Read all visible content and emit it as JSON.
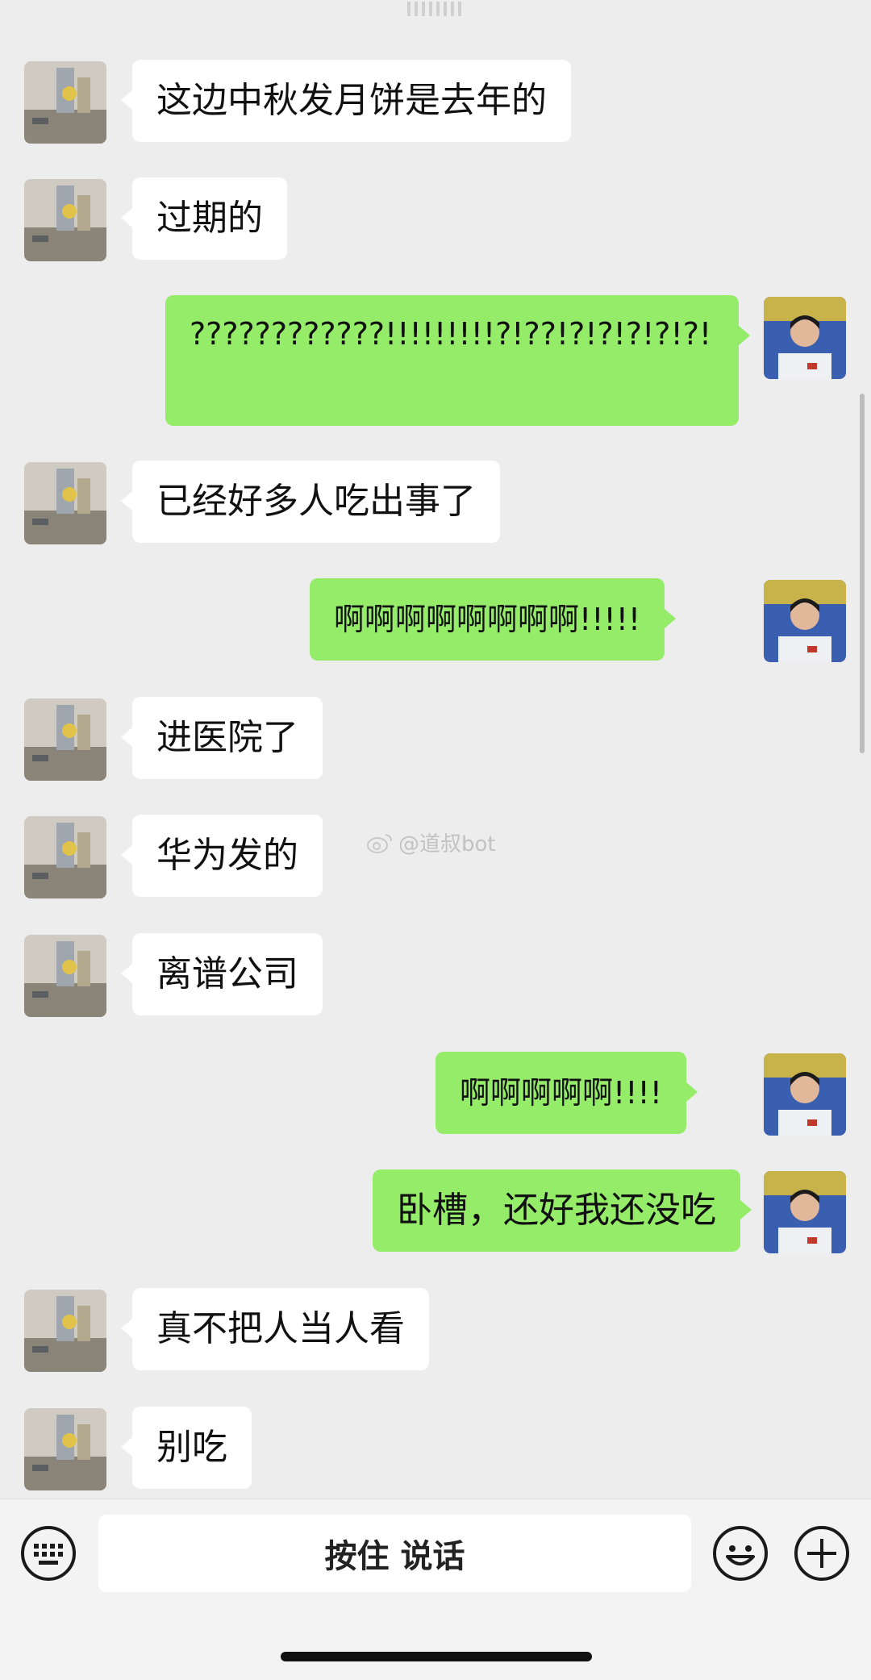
{
  "messages": [
    {
      "side": "them",
      "text": "这边中秋发月饼是去年的"
    },
    {
      "side": "them",
      "text": "过期的"
    },
    {
      "side": "me",
      "text": "????????????!!!!!!!!!?!??!?!?!?!?!?!"
    },
    {
      "side": "them",
      "text": "已经好多人吃出事了"
    },
    {
      "side": "me",
      "text": "啊啊啊啊啊啊啊啊!!!!!"
    },
    {
      "side": "them",
      "text": "进医院了"
    },
    {
      "side": "them",
      "text": "华为发的"
    },
    {
      "side": "them",
      "text": "离谱公司"
    },
    {
      "side": "me",
      "text": "啊啊啊啊啊!!!!"
    },
    {
      "side": "me",
      "text": "卧槽，还好我还没吃"
    },
    {
      "side": "them",
      "text": "真不把人当人看"
    },
    {
      "side": "them",
      "text": "别吃"
    }
  ],
  "watermark": "@道叔bot",
  "input_bar": {
    "voice_label": "按住 说话",
    "keyboard_icon": "keyboard-icon",
    "emoji_icon": "emoji-icon",
    "plus_icon": "plus-icon"
  },
  "colors": {
    "background": "#ededed",
    "my_bubble": "#95ec69",
    "their_bubble": "#ffffff"
  }
}
